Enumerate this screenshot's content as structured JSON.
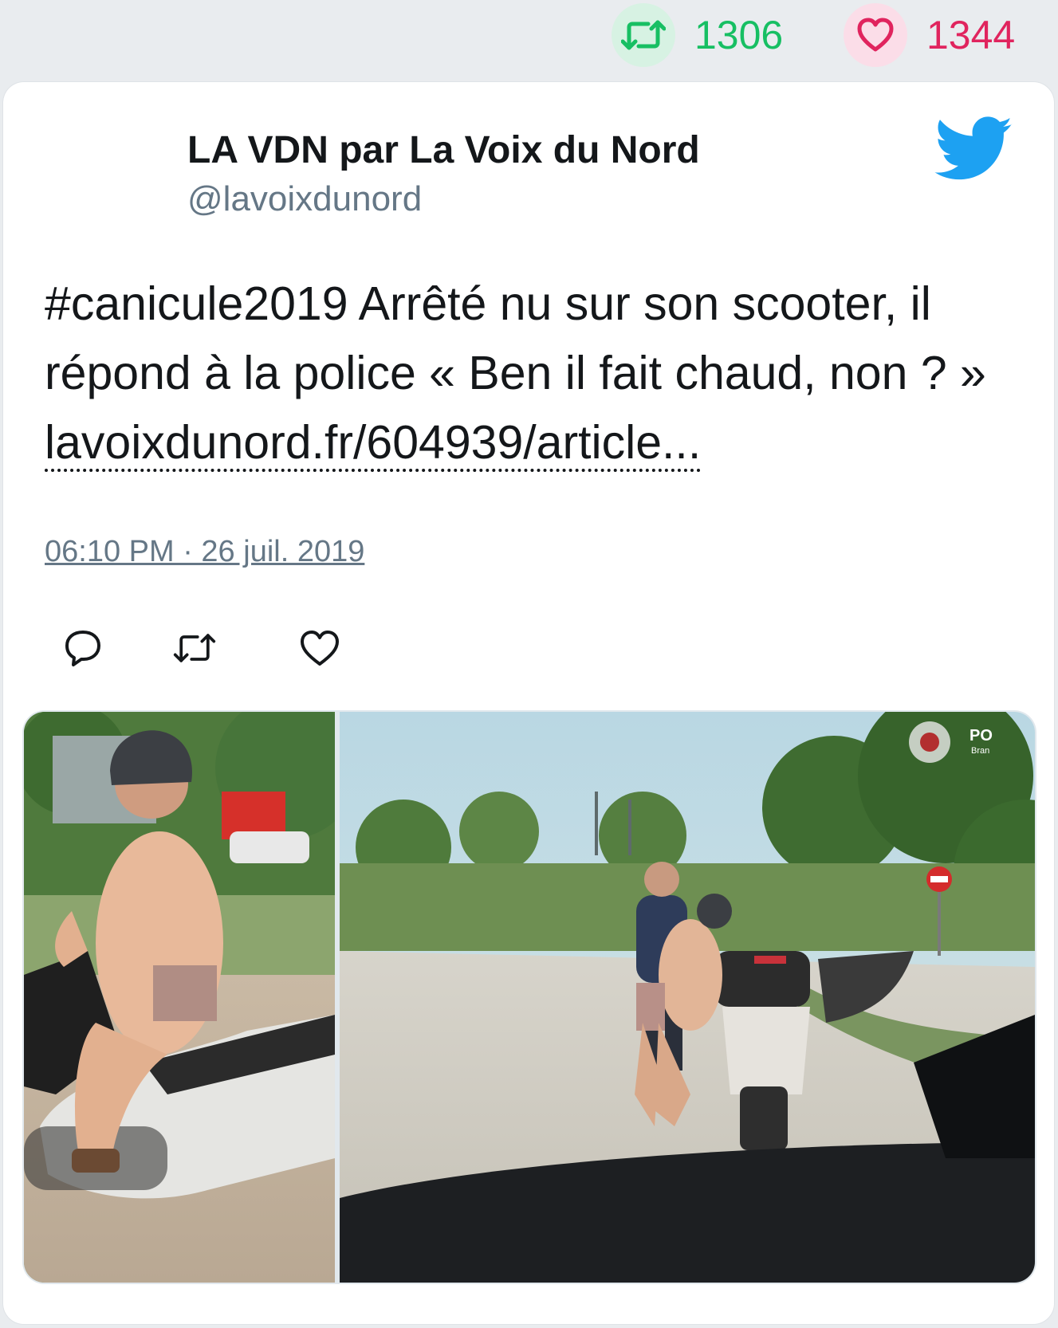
{
  "stats": {
    "retweet_count": "1306",
    "like_count": "1344",
    "retweet_color": "#17bf63",
    "like_color": "#e0245e"
  },
  "tweet": {
    "author_name": "LA VDN par La Voix du Nord",
    "author_handle": "@lavoixdunord",
    "text": "#canicule2019 Arrêté nu sur son scooter, il répond à la police « Ben il fait chaud, non ? » ",
    "link_text": "lavoixdunord.fr/604939/article...",
    "timestamp": "06:10 PM · 26 juil. 2019",
    "brand_icon": "twitter-bird-icon",
    "brand_color": "#1da1f2"
  },
  "actions": {
    "reply_icon": "reply-icon",
    "retweet_icon": "retweet-icon",
    "like_icon": "heart-icon"
  },
  "media": {
    "photos": [
      {
        "name": "photo-left",
        "subject": "scooter-rider-close-up"
      },
      {
        "name": "photo-right",
        "subject": "police-check-street-scene"
      }
    ],
    "watermark_text": "PO",
    "watermark_subtext": "Bran"
  }
}
